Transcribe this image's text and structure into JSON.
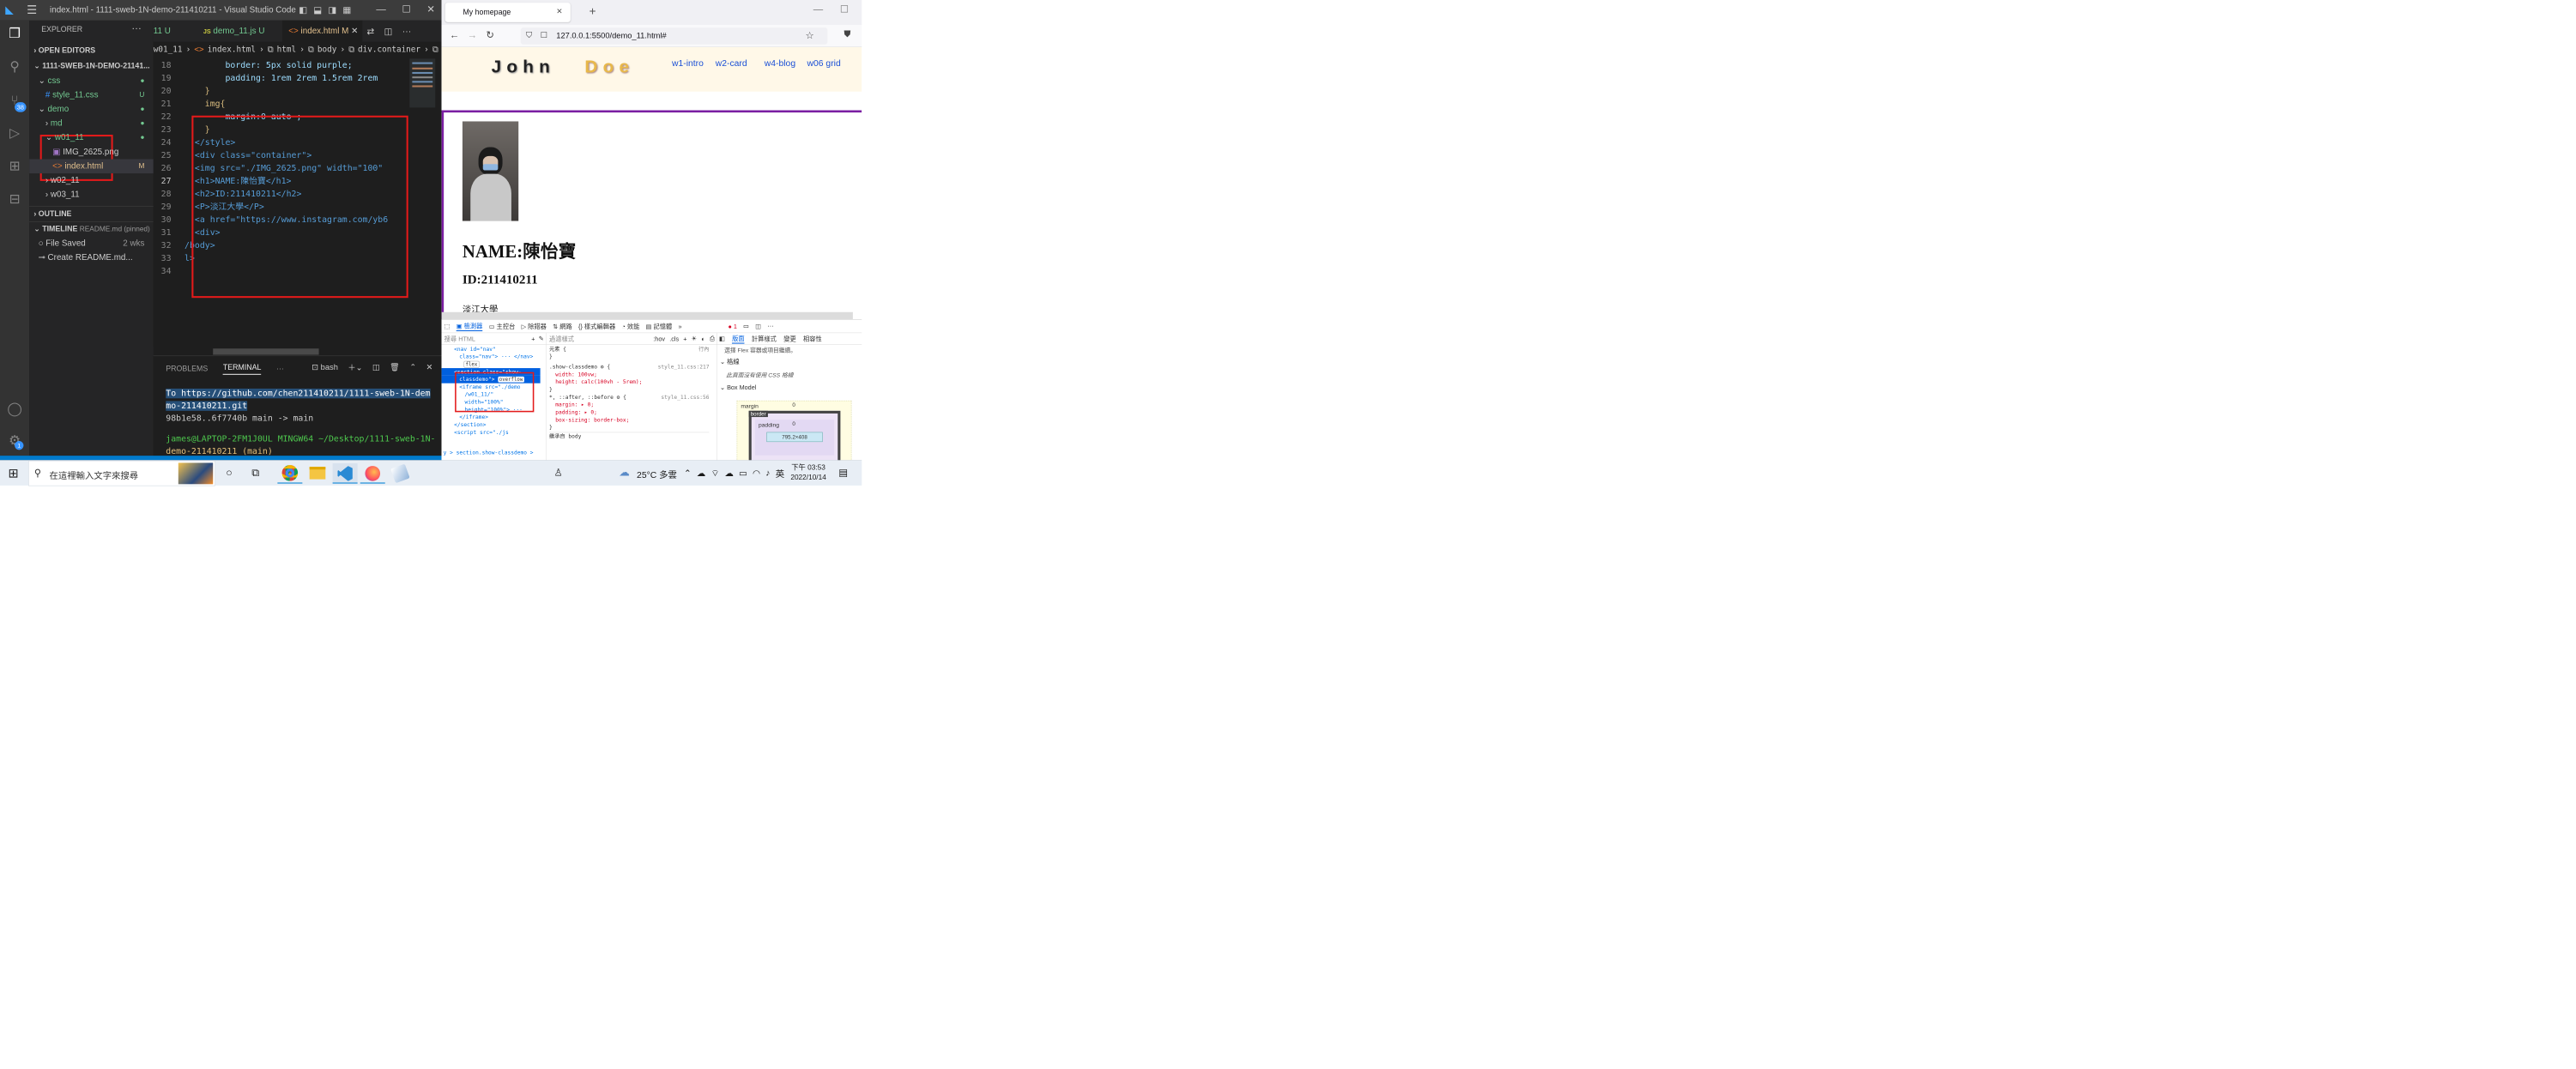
{
  "vscode": {
    "title": "index.html - 1111-sweb-1N-demo-211410211 - Visual Studio Code",
    "tabs": [
      {
        "label": "11 U"
      },
      {
        "label": "demo_11.js U"
      },
      {
        "label": "index.html M"
      }
    ],
    "breadcrumb": [
      "w01_11",
      "index.html",
      "html",
      "body",
      "div.container",
      "h1"
    ],
    "explorer_label": "EXPLORER",
    "open_editors": "OPEN EDITORS",
    "project_name": "1111-SWEB-1N-DEMO-21141...",
    "tree": [
      {
        "label": "css",
        "badge": "●"
      },
      {
        "label": "style_11.css",
        "badge": "U"
      },
      {
        "label": "demo",
        "badge": "●"
      },
      {
        "label": "md",
        "badge": "●"
      },
      {
        "label": "w01_11",
        "badge": "●"
      },
      {
        "label": "IMG_2625.png",
        "badge": ""
      },
      {
        "label": "index.html",
        "badge": "M"
      },
      {
        "label": "w02_11",
        "badge": ""
      },
      {
        "label": "w03_11",
        "badge": ""
      }
    ],
    "outline": "OUTLINE",
    "timeline": "TIMELINE",
    "timeline_file": "README.md (pinned)",
    "timeline_items": [
      {
        "label": "File Saved",
        "time": "2 wks"
      },
      {
        "label": "Create README.md...",
        "time": ""
      }
    ],
    "scm_badge": "38",
    "settings_badge": "1",
    "code_lines": [
      {
        "n": "18",
        "text": "        border: 5px solid purple;"
      },
      {
        "n": "19",
        "text": "        padding: 1rem 2rem 1.5rem 2rem"
      },
      {
        "n": "20",
        "text": "    }"
      },
      {
        "n": "21",
        "text": "    img{"
      },
      {
        "n": "22",
        "text": "        margin:0 auto ;"
      },
      {
        "n": "23",
        "text": "    }"
      },
      {
        "n": "24",
        "text": "  </style>"
      },
      {
        "n": "25",
        "text": "  <div class=\"container\">"
      },
      {
        "n": "26",
        "text": "  <img src=\"./IMG_2625.png\" width=\"100\""
      },
      {
        "n": "27",
        "text": "  <h1>NAME:陳怡寶</h1>"
      },
      {
        "n": "28",
        "text": "  <h2>ID:211410211</h2>"
      },
      {
        "n": "29",
        "text": "  <P>淡江大學</P>"
      },
      {
        "n": "30",
        "text": "  <a href=\"https://www.instagram.com/yb6"
      },
      {
        "n": "31",
        "text": "  <div>"
      },
      {
        "n": "32",
        "text": "/body>"
      },
      {
        "n": "33",
        "text": "l>"
      },
      {
        "n": "34",
        "text": ""
      }
    ],
    "panel_tabs": [
      "PROBLEMS",
      "TERMINAL",
      "···"
    ],
    "terminal_shell": "bash",
    "terminal_lines": [
      "To https://github.com/chen211410211/1111-sweb-1N-dem",
      "mo-211410211.git",
      "   98b1e58..6f7740b  main -> main",
      "",
      "james@LAPTOP-2FM1J0UL MINGW64 ~/Desktop/1111-sweb-1N-",
      "demo-211410211 (main)"
    ]
  },
  "browser": {
    "tab_title": "My homepage",
    "url": "127.0.0.1:5500/demo_11.html#",
    "logo_john": "John",
    "logo_doe": "Doe",
    "nav": [
      "w1-intro",
      "w2-card",
      "w4-blog",
      "w06 grid"
    ],
    "h1": "NAME:陳怡寶",
    "h2": "ID:211410211",
    "p": "淡江大學",
    "devtools": {
      "tabs": [
        "檢測器",
        "主控台",
        "除錯器",
        "網路",
        "樣式編輯器",
        "效能",
        "記憶體"
      ],
      "search_html": "搜尋 HTML",
      "filter_styles": "過濾樣式",
      "hov": ":hov",
      "cls": ".cls",
      "layout_tabs": [
        "版面",
        "計算樣式",
        "變更",
        "相容性"
      ],
      "error_count": "1",
      "html_lines": [
        "<nav id=\"nav\"",
        "class=\"nav\"> ··· </nav>",
        "flex",
        "<section class=\"show-",
        "classdemo\">",
        "overflow",
        "<iframe src=\"./demo",
        "/w01_11/\"",
        "width=\"100%\"",
        "height=\"100%\"> ···",
        "</iframe>",
        "</section>",
        "<script src=\"./js"
      ],
      "rules": [
        "元素 {",
        "}",
        ".show-classdemo",
        "style_11.css:217",
        "width: 100vw;",
        "height: calc(100vh - 5rem);",
        "}",
        "*, ::after, ::before",
        "style_11.css:56",
        "margin: ▸ 0;",
        "padding: ▸ 0;",
        "box-sizing: border-box;",
        "}",
        "繼承自 body"
      ],
      "inline_label": "行內",
      "flex_note": "選擇 Flex 容器或項目繼續。",
      "grid_title": "格線",
      "grid_note": "此頁面沒有使用 CSS 格線",
      "boxmodel_title": "Box Model",
      "box_margin": "margin",
      "box_border": "border",
      "box_padding": "padding",
      "box_size": "795.2×408",
      "box_zero": "0",
      "breadcrumb": "y > section.show-classdemo >"
    }
  },
  "taskbar": {
    "search_placeholder": "在這裡輸入文字來搜尋",
    "weather": "25°C 多雲",
    "ime": "英",
    "time": "下午 03:53",
    "date": "2022/10/14"
  },
  "colors": {
    "purple_border": "#7b1fa2",
    "doe_gold": "#d4a017",
    "nav_link": "#1a4fd6",
    "highlight": "#e31a1a",
    "vscode_blue": "#007acc"
  }
}
